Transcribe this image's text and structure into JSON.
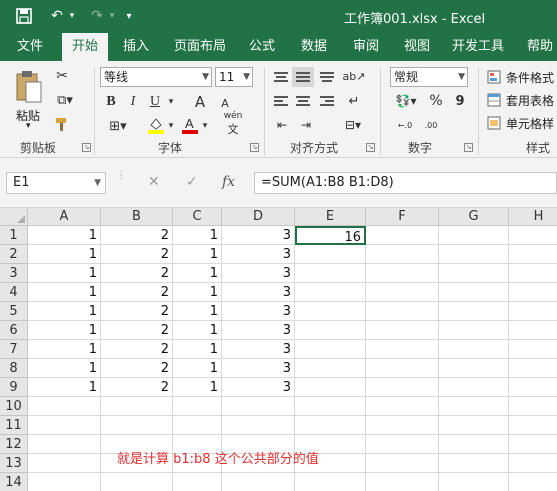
{
  "title": "工作簿001.xlsx  -  Excel",
  "tabs": [
    "文件",
    "开始",
    "插入",
    "页面布局",
    "公式",
    "数据",
    "审阅",
    "视图",
    "开发工具",
    "帮助"
  ],
  "ribbon": {
    "clipboard": {
      "paste": "粘贴",
      "label": "剪贴板"
    },
    "font": {
      "name": "等线",
      "size": "11",
      "bold": "B",
      "italic": "I",
      "underline": "U",
      "grow": "A",
      "shrink": "A",
      "phonetic": "wén",
      "label": "字体"
    },
    "align": {
      "label": "对齐方式"
    },
    "number": {
      "format": "常规",
      "percent": "%",
      "comma": "9",
      "inc": "←.0",
      "dec": ".00",
      "label": "数字"
    },
    "styles": {
      "cond": "条件格式",
      "table": "套用表格",
      "cell": "单元格样",
      "label": "样式"
    }
  },
  "formula_bar": {
    "name_box": "E1",
    "cancel": "✕",
    "enter": "✓",
    "fx": "fx",
    "formula": "=SUM(A1:B8 B1:D8)"
  },
  "columns": [
    "A",
    "B",
    "C",
    "D",
    "E",
    "F",
    "G",
    "H"
  ],
  "rows": [
    "1",
    "2",
    "3",
    "4",
    "5",
    "6",
    "7",
    "8",
    "9",
    "10",
    "11",
    "12",
    "13",
    "14"
  ],
  "cells": {
    "A": [
      "1",
      "1",
      "1",
      "1",
      "1",
      "1",
      "1",
      "1",
      "1"
    ],
    "B": [
      "2",
      "2",
      "2",
      "2",
      "2",
      "2",
      "2",
      "2",
      "2"
    ],
    "C": [
      "1",
      "1",
      "1",
      "1",
      "1",
      "1",
      "1",
      "1",
      "1"
    ],
    "D": [
      "3",
      "3",
      "3",
      "3",
      "3",
      "3",
      "3",
      "3",
      "3"
    ],
    "E1": "16"
  },
  "note": "就是计算 b1:b8 这个公共部分的值",
  "colors": {
    "brand": "#217346",
    "note": "#e03030"
  }
}
